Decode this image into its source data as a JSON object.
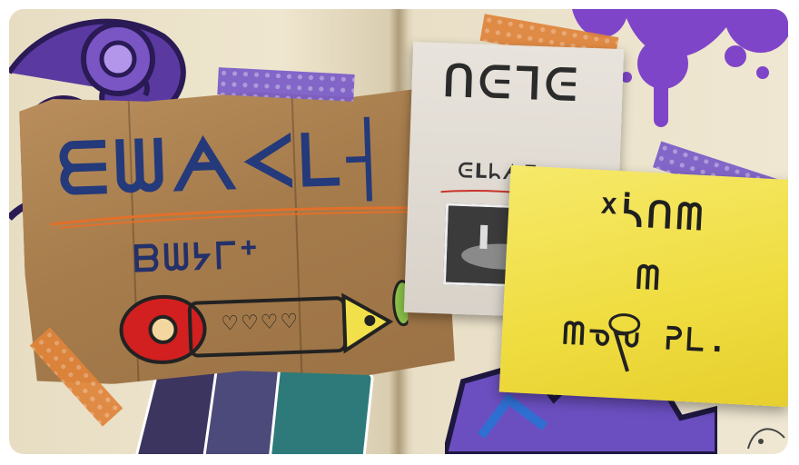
{
  "scene": {
    "description_free": true,
    "colors": {
      "ink_purple": "#6a3bbf",
      "ink_orange": "#e9781e",
      "note_yellow": "#f2df43",
      "ink_blue": "#243a7a"
    }
  },
  "cardboard_sign": {
    "title_glyphs": "ᗴᗯᗅᐸᒪ┤",
    "subtitle_glyphs": "ᗷᗯᔭᒥᕀ",
    "bottle_hearts": "♡♡♡♡"
  },
  "paper_note": {
    "title_glyphs": "ᑎᕮᒣᕮ",
    "subtitle_glyphs": "ᕮᒪᖺᗅᒥ"
  },
  "yellow_note": {
    "line1": "ᕽᓵᑎᗰ",
    "line2": "ᗰ",
    "line3": "ᗰᓀᕃ  ᕈᒪ."
  }
}
